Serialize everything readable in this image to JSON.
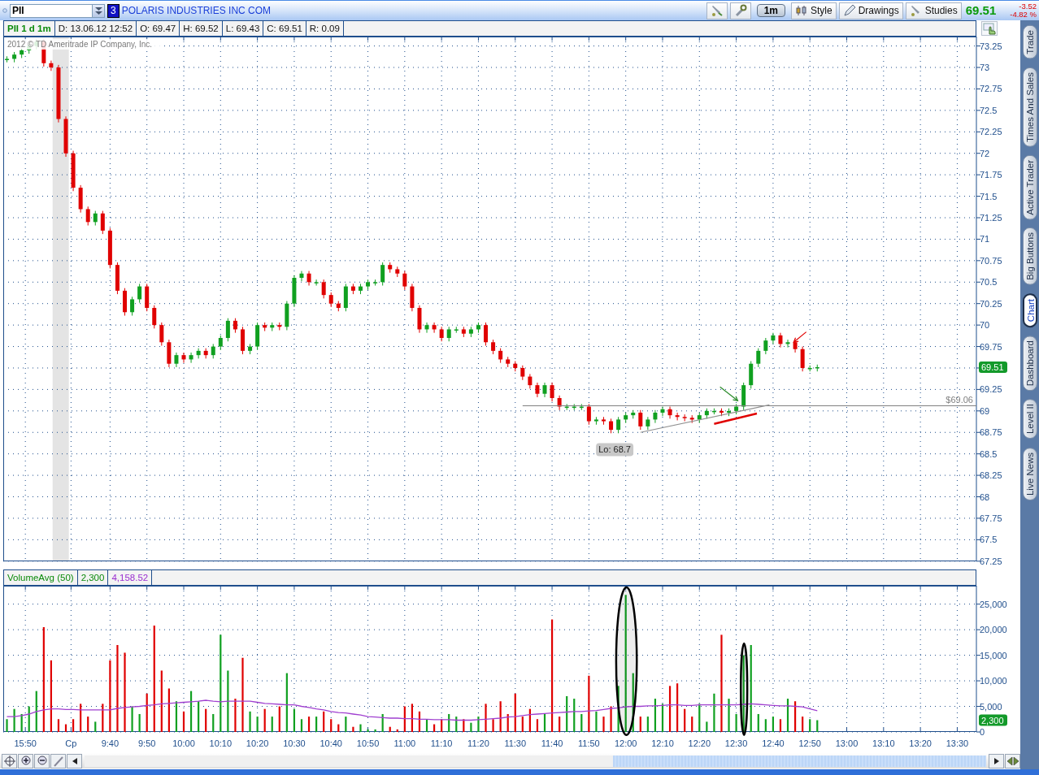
{
  "toolbar": {
    "symbol": "PII",
    "link_group": "3",
    "company": "POLARIS INDUSTRIES INC COM",
    "interval": "1m",
    "buttons": [
      "Style",
      "Drawings",
      "Studies"
    ],
    "last": "69.51",
    "change": "-3.52",
    "change_pct": "-4.82 %"
  },
  "price_panel": {
    "title": "PII 1 d 1m",
    "fields": [
      "D: 13.06.12 12:52",
      "O: 69.47",
      "H: 69.52",
      "L: 69.43",
      "C: 69.51",
      "R: 0.09"
    ],
    "copyright": "2012 © TD Ameritrade IP Company, Inc.",
    "axis_labels_upper": [
      "73.25",
      "73",
      "72.75",
      "72.5",
      "72.25",
      "72",
      "71.75",
      "71.5",
      "71.25",
      "71",
      "70.75",
      "70.5",
      "70.25",
      "70",
      "69.75"
    ],
    "axis_labels_lower": [
      "69.25",
      "69",
      "68.75",
      "68.5",
      "68.25",
      "68",
      "67.75",
      "67.5",
      "67.25"
    ],
    "last_price_tag": "69.51",
    "level_label": "$69.06",
    "low_label": "Lo: 68.7"
  },
  "volume_panel": {
    "study": "VolumeAvg (50)",
    "fields": [
      {
        "text": "2,300",
        "color": "#0a8a0a"
      },
      {
        "text": "4,158.52",
        "color": "#9a2ed0"
      }
    ],
    "axis_labels": [
      "25,000",
      "20,000",
      "15,000",
      "10,000",
      "5,000",
      "0"
    ],
    "last_volume_tag": "2,300"
  },
  "time_axis": {
    "labels": [
      "15:50",
      "Cp",
      "9:40",
      "9:50",
      "10:00",
      "10:10",
      "10:20",
      "10:30",
      "10:40",
      "10:50",
      "11:00",
      "11:10",
      "11:20",
      "11:30",
      "11:40",
      "11:50",
      "12:00",
      "12:10",
      "12:20",
      "12:30",
      "12:40",
      "12:50",
      "13:00",
      "13:10",
      "13:20",
      "13:30"
    ]
  },
  "sidebar": {
    "tabs": [
      {
        "label": "Trade",
        "selected": false
      },
      {
        "label": "Times And Sales",
        "selected": false
      },
      {
        "label": "Active Trader",
        "selected": false
      },
      {
        "label": "Big Buttons",
        "selected": false
      },
      {
        "label": "Chart",
        "selected": true
      },
      {
        "label": "Dashboard",
        "selected": false
      },
      {
        "label": "Level II",
        "selected": false
      },
      {
        "label": "Live News",
        "selected": false
      }
    ]
  }
}
